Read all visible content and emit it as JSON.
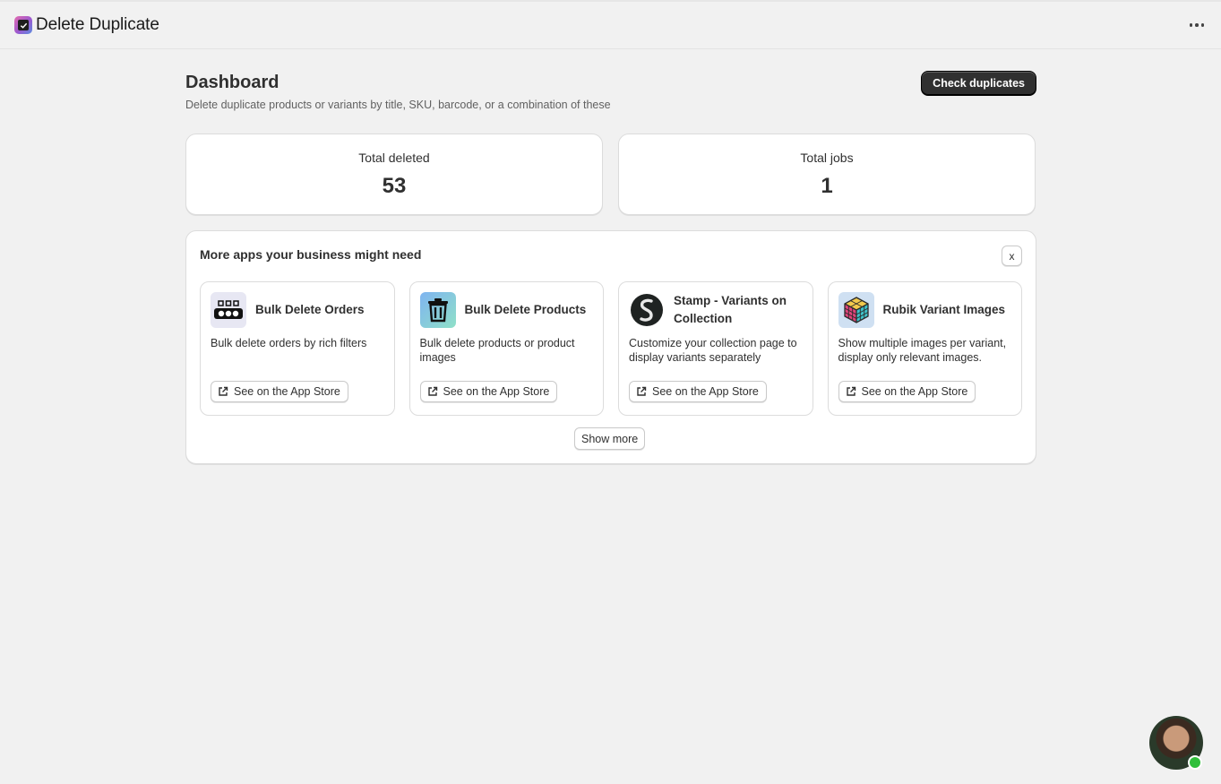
{
  "topbar": {
    "app_title": "Delete Duplicate",
    "app_icon": "checkbox-icon",
    "more_icon": "more-horizontal-icon"
  },
  "page": {
    "title": "Dashboard",
    "subtitle": "Delete duplicate products or variants by title, SKU, barcode, or a combination of these",
    "primary_action": "Check duplicates"
  },
  "stats": [
    {
      "label": "Total deleted",
      "value": "53"
    },
    {
      "label": "Total jobs",
      "value": "1"
    }
  ],
  "apps_section": {
    "title": "More apps your business might need",
    "close_label": "x",
    "show_more_label": "Show more",
    "apps": [
      {
        "name": "Bulk Delete Orders",
        "description": "Bulk delete orders by rich filters",
        "button": "See on the App Store",
        "icon": "orders-icon"
      },
      {
        "name": "Bulk Delete Products",
        "description": "Bulk delete products or product images",
        "button": "See on the App Store",
        "icon": "trash-icon"
      },
      {
        "name": "Stamp - Variants on Collection",
        "description": "Customize your collection page to display variants separately",
        "button": "See on the App Store",
        "icon": "stamp-logo-icon"
      },
      {
        "name": "Rubik Variant Images",
        "description": "Show multiple images per variant, display only relevant images.",
        "button": "See on the App Store",
        "icon": "rubik-cube-icon"
      }
    ]
  },
  "colors": {
    "background": "#f1f1f1",
    "primary_button": "#303030",
    "online_status": "#2fbf3a"
  }
}
